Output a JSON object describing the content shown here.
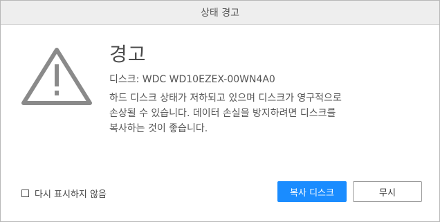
{
  "window": {
    "title": "상태 경고"
  },
  "alert": {
    "icon": "warning-triangle-icon",
    "heading": "경고",
    "disk": "디스크: WDC WD10EZEX-00WN4A0",
    "message_lines": [
      "하드 디스크 상태가 저하되고 있으며 디스크가 영구적으로",
      "손상될 수 있습니다. 데이터 손실을 방지하려면 디스크를",
      "복사하는 것이 좋습니다."
    ]
  },
  "footer": {
    "dont_show_label": "다시 표시하지 않음",
    "dont_show_checked": false
  },
  "buttons": {
    "primary_label": "복사 디스크",
    "secondary_label": "무시"
  },
  "colors": {
    "accent": "#1a8cff",
    "icon_gray": "#8a8a8a"
  }
}
